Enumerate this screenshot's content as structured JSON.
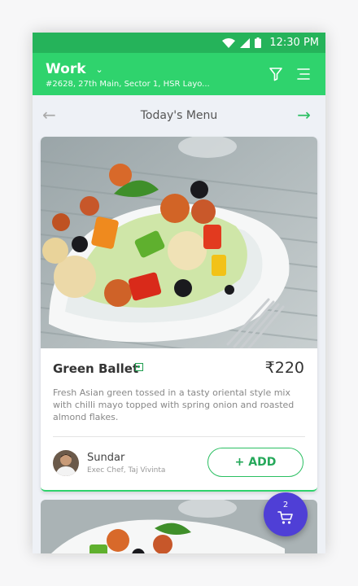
{
  "status_bar": {
    "time": "12:30 PM"
  },
  "header": {
    "location_title": "Work",
    "address": "#2628, 27th Main, Sector 1, HSR Layo..."
  },
  "menu_nav": {
    "title": "Today's Menu"
  },
  "dish": {
    "name": "Green Ballet",
    "price": "₹220",
    "description": "Fresh Asian green tossed in a tasty oriental style mix with chilli mayo  topped with spring onion and roasted almond flakes.",
    "chef_name": "Sundar",
    "chef_role": "Exec Chef, Taj Vivinta",
    "add_label": "+ ADD"
  },
  "cart": {
    "count": "2"
  },
  "colors": {
    "status_bar": "#25b35a",
    "app_bar": "#2fd36d",
    "accent_green": "#25a85a",
    "cart_fab": "#4f3fd6"
  },
  "icons": [
    "wifi-icon",
    "signal-icon",
    "battery-icon",
    "chevron-down-icon",
    "filter-icon",
    "menu-icon",
    "arrow-left-icon",
    "arrow-right-icon",
    "veg-icon",
    "cart-icon"
  ]
}
